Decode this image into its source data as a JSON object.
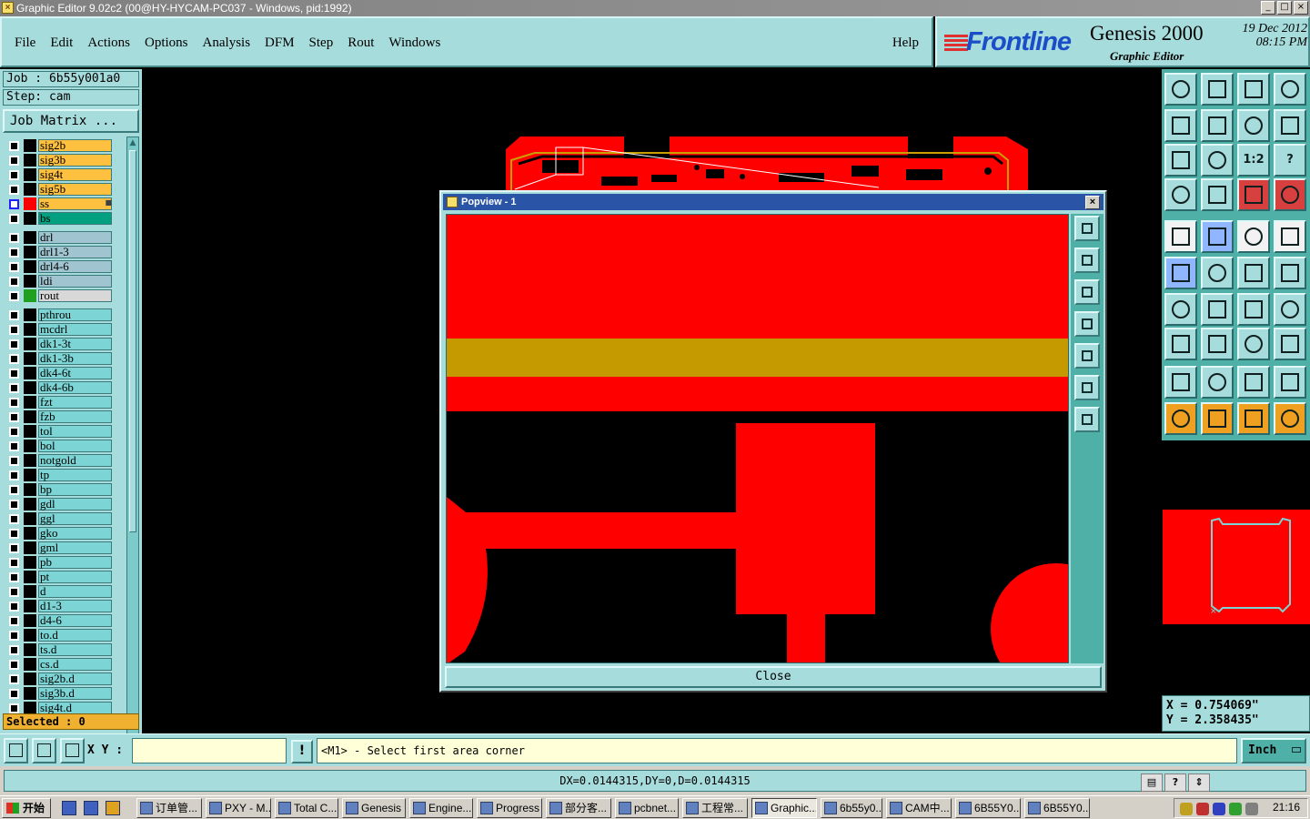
{
  "window": {
    "title": "Graphic Editor 9.02c2 (00@HY-HYCAM-PC037 - Windows, pid:1992)",
    "controls": [
      "_",
      "□",
      "×"
    ]
  },
  "menu": {
    "items": [
      "File",
      "Edit",
      "Actions",
      "Options",
      "Analysis",
      "DFM",
      "Step",
      "Rout",
      "Windows"
    ],
    "help": "Help"
  },
  "brand": {
    "logo": "Frontline",
    "product": "Genesis 2000",
    "subtitle": "Graphic Editor",
    "date": "19 Dec 2012",
    "time": "08:15 PM"
  },
  "job": {
    "job_label": "Job : 6b55y001a0",
    "step_label": "Step: cam",
    "matrix_button": "Job Matrix ...",
    "selected": "Selected : 0"
  },
  "layers": [
    {
      "name": "sig2b",
      "color": "#ffc040"
    },
    {
      "name": "sig3b",
      "color": "#ffc040"
    },
    {
      "name": "sig4t",
      "color": "#ffc040"
    },
    {
      "name": "sig5b",
      "color": "#ffc040"
    },
    {
      "name": "ss",
      "color": "#ffc040",
      "swatch": "#ff0000",
      "selected": true,
      "marker": "■"
    },
    {
      "name": "bs",
      "color": "#00a080"
    },
    {
      "name": "drl",
      "color": "#a0c4d0"
    },
    {
      "name": "drl1-3",
      "color": "#a0c4d0"
    },
    {
      "name": "drl4-6",
      "color": "#a0c4d0"
    },
    {
      "name": "ldi",
      "color": "#a0c4d0"
    },
    {
      "name": "rout",
      "color": "#d8d8d8",
      "swatch": "#20a020"
    },
    {
      "name": "pthrou",
      "color": "#7cd4d4"
    },
    {
      "name": "mcdrl",
      "color": "#7cd4d4"
    },
    {
      "name": "dk1-3t",
      "color": "#7cd4d4"
    },
    {
      "name": "dk1-3b",
      "color": "#7cd4d4"
    },
    {
      "name": "dk4-6t",
      "color": "#7cd4d4"
    },
    {
      "name": "dk4-6b",
      "color": "#7cd4d4"
    },
    {
      "name": "fzt",
      "color": "#7cd4d4"
    },
    {
      "name": "fzb",
      "color": "#7cd4d4"
    },
    {
      "name": "tol",
      "color": "#7cd4d4"
    },
    {
      "name": "bol",
      "color": "#7cd4d4"
    },
    {
      "name": "notgold",
      "color": "#7cd4d4"
    },
    {
      "name": "tp",
      "color": "#7cd4d4"
    },
    {
      "name": "bp",
      "color": "#7cd4d4"
    },
    {
      "name": "gdl",
      "color": "#7cd4d4"
    },
    {
      "name": "ggl",
      "color": "#7cd4d4"
    },
    {
      "name": "gko",
      "color": "#7cd4d4"
    },
    {
      "name": "gml",
      "color": "#7cd4d4"
    },
    {
      "name": "pb",
      "color": "#7cd4d4"
    },
    {
      "name": "pt",
      "color": "#7cd4d4"
    },
    {
      "name": "d",
      "color": "#7cd4d4"
    },
    {
      "name": "d1-3",
      "color": "#7cd4d4"
    },
    {
      "name": "d4-6",
      "color": "#7cd4d4"
    },
    {
      "name": "to.d",
      "color": "#7cd4d4"
    },
    {
      "name": "ts.d",
      "color": "#7cd4d4"
    },
    {
      "name": "cs.d",
      "color": "#7cd4d4"
    },
    {
      "name": "sig2b.d",
      "color": "#7cd4d4"
    },
    {
      "name": "sig3b.d",
      "color": "#7cd4d4"
    },
    {
      "name": "sig4t.d",
      "color": "#7cd4d4"
    }
  ],
  "popview": {
    "title": "Popview - 1",
    "close_label": "Close",
    "close_x": "×"
  },
  "right_tools": {
    "ratio_label": "1:2",
    "help_label": "?"
  },
  "coords": {
    "x": "X = 0.754069\"",
    "y": "Y = 2.358435\""
  },
  "command": {
    "xy_label": "X Y :",
    "xy_value": "",
    "bang": "!",
    "prompt": "<M1> - Select first area corner",
    "unit": "Inch"
  },
  "status": {
    "measure": "DX=0.0144315,DY=0,D=0.0144315",
    "icons": [
      "▤",
      "?",
      "⇕"
    ]
  },
  "taskbar": {
    "start": "开始",
    "items": [
      {
        "label": "订单管..."
      },
      {
        "label": "PXY - M..."
      },
      {
        "label": "Total C..."
      },
      {
        "label": "Genesis"
      },
      {
        "label": "Engine..."
      },
      {
        "label": "Progress"
      },
      {
        "label": "部分客..."
      },
      {
        "label": "pcbnet..."
      },
      {
        "label": "工程常..."
      },
      {
        "label": "Graphic...",
        "active": true
      },
      {
        "label": "6b55y0..."
      },
      {
        "label": "CAM中..."
      },
      {
        "label": "6B55Y0..."
      },
      {
        "label": "6B55Y0..."
      }
    ],
    "clock": "21:16"
  }
}
